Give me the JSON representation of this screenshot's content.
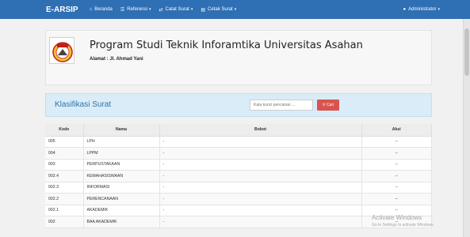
{
  "navbar": {
    "brand": "E-ARSIP",
    "items": [
      {
        "icon": "home-icon",
        "label": "Beranda",
        "dropdown": false
      },
      {
        "icon": "list-icon",
        "label": "Referensi",
        "dropdown": true
      },
      {
        "icon": "shuffle-icon",
        "label": "Catat Surat",
        "dropdown": true
      },
      {
        "icon": "print-icon",
        "label": "Cetak Surat",
        "dropdown": true
      }
    ],
    "user": "Administrator"
  },
  "header": {
    "title": "Program Studi Teknik Inforamtika Universitas Asahan",
    "address": "Alamat : Jl. Ahmad Yani"
  },
  "panel": {
    "title": "Klasifikasi Surat",
    "search_placeholder": "Kata kunci pencarian ...",
    "search_button": "Cari"
  },
  "table": {
    "columns": [
      "Kode",
      "Nama",
      "Bobot",
      "Aksi"
    ],
    "rows": [
      [
        "005",
        "LPH",
        "-",
        "--"
      ],
      [
        "004",
        "LPPM",
        "-",
        "--"
      ],
      [
        "003",
        "PERPUSTAKAAN",
        "-",
        "--"
      ],
      [
        "002.4",
        "KEMAHASISWAAN",
        "-",
        "--"
      ],
      [
        "002.3",
        "INFORMASI",
        "-",
        "--"
      ],
      [
        "002.2",
        "PERENCANAAN",
        "-",
        "--"
      ],
      [
        "002.1",
        "AKADEMIK",
        "-",
        "--"
      ],
      [
        "002",
        "BAA AKADEMIK",
        "-",
        "--"
      ]
    ]
  },
  "watermark": {
    "title": "Activate Windows",
    "subtitle": "Go to Settings to activate Windows."
  },
  "colors": {
    "navbar": "#2f6fb3",
    "panel": "#d9ecf7",
    "search_button": "#d9534f"
  }
}
